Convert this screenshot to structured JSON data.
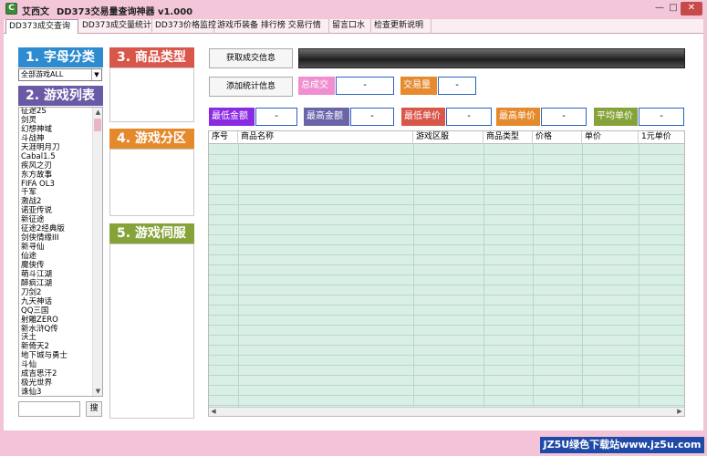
{
  "window": {
    "app_name": "艾西文",
    "title": "DD373交易量查询神器 v1.000",
    "min_glyph": "—",
    "max_glyph": "□",
    "close_glyph": "✕"
  },
  "tabs": [
    {
      "label": "DD373成交查询",
      "active": true
    },
    {
      "label": "DD373成交量统计",
      "active": false
    },
    {
      "label": "DD373价格监控",
      "active": false
    },
    {
      "label": "游戏币装备 排行榜 交易行情",
      "active": false
    },
    {
      "label": "留言口水",
      "active": false
    },
    {
      "label": "检查更新说明",
      "active": false
    }
  ],
  "sections": {
    "letter": "1. 字母分类",
    "games": "2. 游戏列表",
    "product_type": "3. 商品类型",
    "zone": "4. 游戏分区",
    "server": "5. 游戏伺服"
  },
  "letter_select": {
    "value": "全部游戏ALL"
  },
  "games": [
    "征途2S",
    "剑灵",
    "幻想神域",
    "斗战神",
    "天涯明月刀",
    "Cabal1.5",
    "疾风之刃",
    "东方故事",
    "FIFA  OL3",
    "千军",
    "激战2",
    "诺亚传说",
    "新征途",
    "征途2经典版",
    "剑侠情缘III",
    "新寻仙",
    "仙途",
    "魔侠传",
    "萌斗江湖",
    "醉疯江湖",
    "刀剑2",
    "九天神话",
    "QQ三国",
    "射雕ZERO",
    "新水浒Q传",
    "沃土",
    "新倚天2",
    "地下城与勇士",
    "斗仙",
    "成吉思汗2",
    "极光世界",
    "诛仙3"
  ],
  "search": {
    "button": "搜"
  },
  "buttons": {
    "fetch": "获取成交信息",
    "add_stats": "添加统计信息"
  },
  "stats": {
    "total_deal": {
      "label": "总成交",
      "value": "-",
      "color": "#f08fd0"
    },
    "volume": {
      "label": "交易量",
      "value": "-",
      "color": "#e58a2e"
    },
    "min_amount": {
      "label": "最低金额",
      "value": "-",
      "color": "#8a2be2"
    },
    "max_amount": {
      "label": "最高金额",
      "value": "-",
      "color": "#6a64a8"
    },
    "min_price": {
      "label": "最低单价",
      "value": "-",
      "color": "#d9564a"
    },
    "max_price": {
      "label": "最高单价",
      "value": "-",
      "color": "#e48a2c"
    },
    "avg_price": {
      "label": "平均单价",
      "value": "-",
      "color": "#86a33a"
    }
  },
  "table": {
    "columns": [
      "序号",
      "商品名称",
      "游戏区服",
      "商品类型",
      "价格",
      "单价",
      "1元单价"
    ]
  },
  "watermark": "JZ5U绿色下载站www.jz5u.com"
}
